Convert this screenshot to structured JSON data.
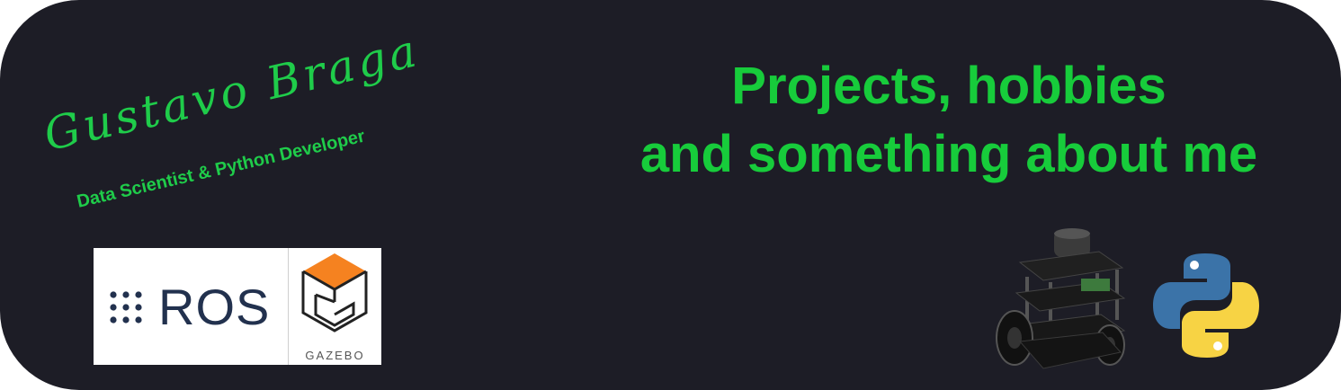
{
  "header": {
    "name": "Gustavo Braga",
    "role": "Data Scientist & Python Developer",
    "headline_line1": "Projects, hobbies",
    "headline_line2": "and something about me"
  },
  "logos": {
    "ros_label": "ROS",
    "gazebo_label": "GAZEBO",
    "robot_icon": "turtlebot-robot-icon",
    "python_icon": "python-logo-icon"
  },
  "colors": {
    "background": "#1d1d26",
    "accent": "#17cc3b",
    "ros_text": "#22314e",
    "gazebo_orange": "#f58220",
    "python_blue": "#3b73a8",
    "python_yellow": "#f7d344"
  }
}
